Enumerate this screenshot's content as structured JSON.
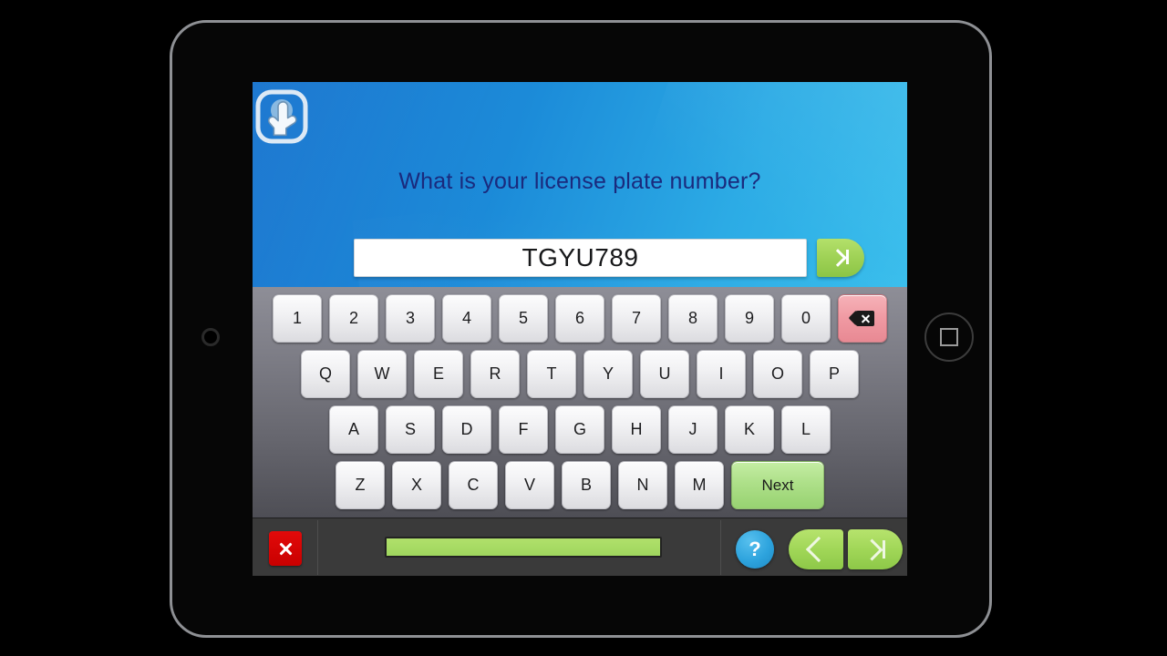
{
  "device": {
    "camera_icon": "camera-dot-icon",
    "home_icon": "home-square-icon"
  },
  "app": {
    "logo_icon": "touch-hand-icon",
    "question": "What is your license plate number?"
  },
  "answer": {
    "value": "TGYU789",
    "placeholder": "",
    "submit_icon": "skip-forward-icon"
  },
  "keyboard": {
    "rows": [
      {
        "keys": [
          {
            "label": "1",
            "type": "digit"
          },
          {
            "label": "2",
            "type": "digit"
          },
          {
            "label": "3",
            "type": "digit"
          },
          {
            "label": "4",
            "type": "digit"
          },
          {
            "label": "5",
            "type": "digit"
          },
          {
            "label": "6",
            "type": "digit"
          },
          {
            "label": "7",
            "type": "digit"
          },
          {
            "label": "8",
            "type": "digit"
          },
          {
            "label": "9",
            "type": "digit"
          },
          {
            "label": "0",
            "type": "digit"
          },
          {
            "label": "",
            "type": "backspace",
            "icon": "backspace-icon"
          }
        ]
      },
      {
        "keys": [
          {
            "label": "Q",
            "type": "letter"
          },
          {
            "label": "W",
            "type": "letter"
          },
          {
            "label": "E",
            "type": "letter"
          },
          {
            "label": "R",
            "type": "letter"
          },
          {
            "label": "T",
            "type": "letter"
          },
          {
            "label": "Y",
            "type": "letter"
          },
          {
            "label": "U",
            "type": "letter"
          },
          {
            "label": "I",
            "type": "letter"
          },
          {
            "label": "O",
            "type": "letter"
          },
          {
            "label": "P",
            "type": "letter"
          }
        ]
      },
      {
        "keys": [
          {
            "label": "A",
            "type": "letter"
          },
          {
            "label": "S",
            "type": "letter"
          },
          {
            "label": "D",
            "type": "letter"
          },
          {
            "label": "F",
            "type": "letter"
          },
          {
            "label": "G",
            "type": "letter"
          },
          {
            "label": "H",
            "type": "letter"
          },
          {
            "label": "J",
            "type": "letter"
          },
          {
            "label": "K",
            "type": "letter"
          },
          {
            "label": "L",
            "type": "letter"
          }
        ]
      },
      {
        "keys": [
          {
            "label": "Z",
            "type": "letter"
          },
          {
            "label": "X",
            "type": "letter"
          },
          {
            "label": "C",
            "type": "letter"
          },
          {
            "label": "V",
            "type": "letter"
          },
          {
            "label": "B",
            "type": "letter"
          },
          {
            "label": "N",
            "type": "letter"
          },
          {
            "label": "M",
            "type": "letter"
          },
          {
            "label": "Next",
            "type": "action"
          }
        ]
      }
    ]
  },
  "toolbar": {
    "close_icon": "close-x-icon",
    "progress_percent": 100,
    "help_label": "?",
    "back_icon": "chevron-left-icon",
    "next_icon": "skip-forward-icon"
  },
  "colors": {
    "header_blue_dark": "#0f6fcd",
    "header_blue_light": "#36bdec",
    "question_text": "#1a2a7d",
    "accent_green": "#a0d657",
    "close_red": "#c90000",
    "backspace_pink": "#f09aa3",
    "help_blue": "#2da3dd",
    "toolbar_gray": "#3a3a3a"
  }
}
